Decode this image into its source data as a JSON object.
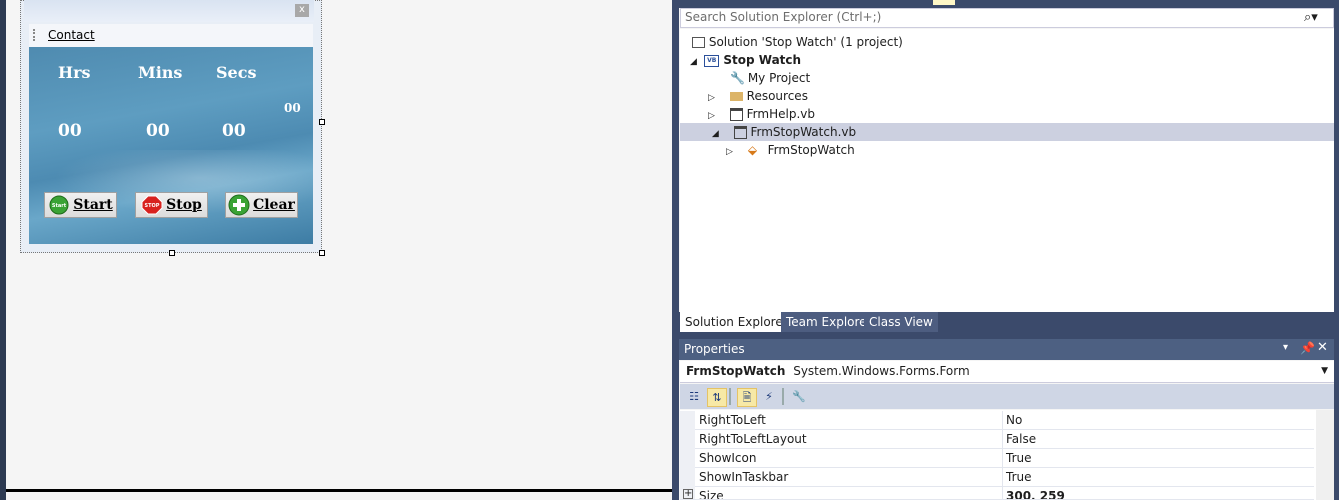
{
  "form": {
    "close_glyph": "x",
    "menu_contact": "Contact",
    "labels": {
      "hrs": "Hrs",
      "mins": "Mins",
      "secs": "Secs"
    },
    "values": {
      "hrs": "00",
      "mins": "00",
      "secs": "00",
      "ms": "00"
    },
    "buttons": {
      "start": "Start",
      "stop": "Stop",
      "clear": "Clear"
    },
    "button_icon_text": {
      "start": "Start",
      "stop": "STOP"
    }
  },
  "solution_explorer": {
    "search_placeholder": "Search Solution Explorer (Ctrl+;)",
    "tree": {
      "solution": "Solution 'Stop Watch' (1 project)",
      "project": "Stop Watch",
      "my_project": "My Project",
      "resources": "Resources",
      "frmhelp": "FrmHelp.vb",
      "frmstopwatch": "FrmStopWatch.vb",
      "frmstopwatch_class": "FrmStopWatch"
    },
    "tabs": [
      "Solution Explorer",
      "Team Explorer",
      "Class View"
    ]
  },
  "properties": {
    "title": "Properties",
    "object_name": "FrmStopWatch",
    "object_type": "System.Windows.Forms.Form",
    "rows": [
      {
        "name": "RightToLeft",
        "value": "No"
      },
      {
        "name": "RightToLeftLayout",
        "value": "False"
      },
      {
        "name": "ShowIcon",
        "value": "True"
      },
      {
        "name": "ShowInTaskbar",
        "value": "True"
      },
      {
        "name": "Size",
        "value": "300, 259"
      }
    ]
  },
  "colors": {
    "accent": "#3b4a6b",
    "panel_blue": "#4f8bb0",
    "selection": "#ccd0e0"
  }
}
